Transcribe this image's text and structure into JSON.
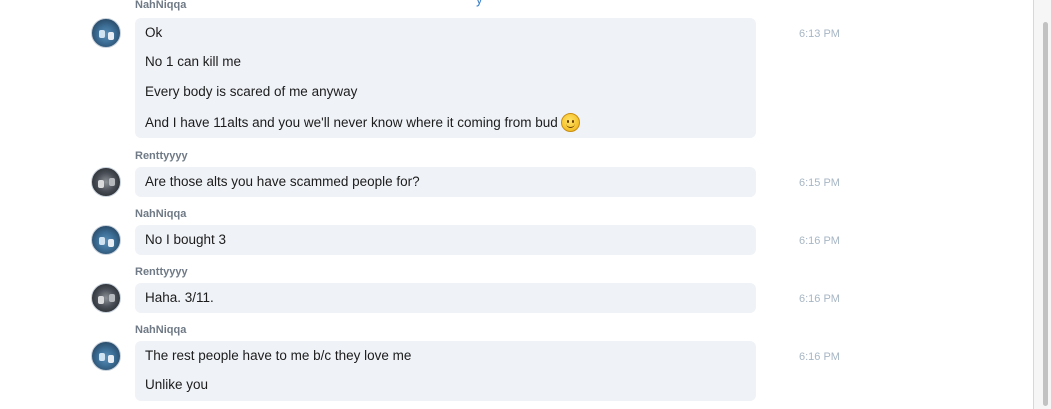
{
  "messages": [
    {
      "author": "NahNiqqa",
      "avatar": "blue",
      "time": "6:13 PM",
      "lines": [
        "Ok",
        "No 1 can kill me",
        "Every body is scared of me anyway",
        "And I have 11alts and you we'll never know where it coming from bud"
      ],
      "emoji": "smiley-emoji"
    },
    {
      "author": "Renttyyyy",
      "avatar": "dark",
      "time": "6:15 PM",
      "lines": [
        "Are those alts you have scammed people for?"
      ]
    },
    {
      "author": "NahNiqqa",
      "avatar": "blue",
      "time": "6:16 PM",
      "lines": [
        "No I bought 3"
      ]
    },
    {
      "author": "Renttyyyy",
      "avatar": "dark",
      "time": "6:16 PM",
      "lines": [
        "Haha. 3/11."
      ]
    },
    {
      "author": "NahNiqqa",
      "avatar": "blue",
      "time": "6:16 PM",
      "lines": [
        "The rest people have to me b/c they love me",
        "Unlike you"
      ]
    }
  ],
  "top_fragment": "y",
  "colors": {
    "bubble": "#eff2f7",
    "author": "#6f7a86",
    "time": "#a7b6c4",
    "link": "#3b7fc6"
  }
}
